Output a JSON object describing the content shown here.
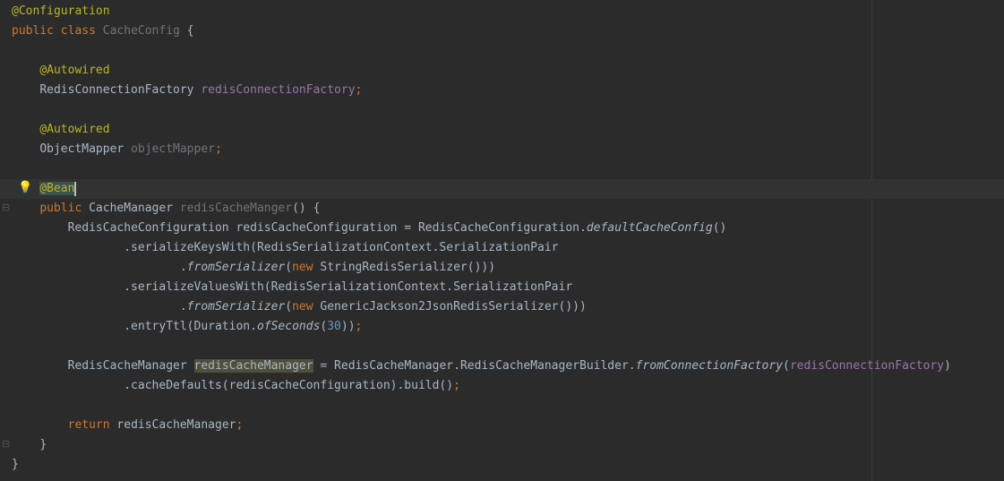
{
  "editor": {
    "language": "Java",
    "lines": [
      {
        "indent": "",
        "tokens": [
          {
            "t": "@Configuration",
            "c": "ann"
          }
        ]
      },
      {
        "indent": "",
        "tokens": [
          {
            "t": "public",
            "c": "kw"
          },
          {
            "t": " "
          },
          {
            "t": "class",
            "c": "kw"
          },
          {
            "t": " "
          },
          {
            "t": "CacheConfig",
            "c": "unused"
          },
          {
            "t": " {"
          }
        ]
      },
      {
        "indent": "",
        "tokens": []
      },
      {
        "indent": "    ",
        "tokens": [
          {
            "t": "@Autowired",
            "c": "ann"
          }
        ]
      },
      {
        "indent": "    ",
        "tokens": [
          {
            "t": "RedisConnectionFactory "
          },
          {
            "t": "redisConnectionFactory",
            "c": "fld"
          },
          {
            "t": ";",
            "c": "kw"
          }
        ]
      },
      {
        "indent": "",
        "tokens": []
      },
      {
        "indent": "    ",
        "tokens": [
          {
            "t": "@Autowired",
            "c": "ann"
          }
        ]
      },
      {
        "indent": "    ",
        "tokens": [
          {
            "t": "ObjectMapper "
          },
          {
            "t": "objectMapper",
            "c": "unused"
          },
          {
            "t": ";",
            "c": "kw"
          }
        ]
      },
      {
        "indent": "",
        "tokens": []
      },
      {
        "indent": "    ",
        "caret": true,
        "tokens": [
          {
            "t": "@Bean",
            "c": "ann sel-ann"
          }
        ]
      },
      {
        "indent": "    ",
        "tokens": [
          {
            "t": "public",
            "c": "kw"
          },
          {
            "t": " CacheManager "
          },
          {
            "t": "redisCacheManger",
            "c": "unused"
          },
          {
            "t": "() {"
          }
        ]
      },
      {
        "indent": "        ",
        "tokens": [
          {
            "t": "RedisCacheConfiguration redisCacheConfiguration = RedisCacheConfiguration."
          },
          {
            "t": "defaultCacheConfig",
            "c": "it"
          },
          {
            "t": "()"
          }
        ]
      },
      {
        "indent": "                ",
        "tokens": [
          {
            "t": ".serializeKeysWith(RedisSerializationContext.SerializationPair"
          }
        ]
      },
      {
        "indent": "                        ",
        "tokens": [
          {
            "t": "."
          },
          {
            "t": "fromSerializer",
            "c": "it"
          },
          {
            "t": "("
          },
          {
            "t": "new",
            "c": "kw"
          },
          {
            "t": " StringRedisSerializer()))"
          }
        ]
      },
      {
        "indent": "                ",
        "tokens": [
          {
            "t": ".serializeValuesWith(RedisSerializationContext.SerializationPair"
          }
        ]
      },
      {
        "indent": "                        ",
        "tokens": [
          {
            "t": "."
          },
          {
            "t": "fromSerializer",
            "c": "it"
          },
          {
            "t": "("
          },
          {
            "t": "new",
            "c": "kw"
          },
          {
            "t": " GenericJackson2JsonRedisSerializer()))"
          }
        ]
      },
      {
        "indent": "                ",
        "tokens": [
          {
            "t": ".entryTtl(Duration."
          },
          {
            "t": "ofSeconds",
            "c": "it"
          },
          {
            "t": "("
          },
          {
            "t": "30",
            "c": "num"
          },
          {
            "t": "))"
          },
          {
            "t": ";",
            "c": "kw"
          }
        ]
      },
      {
        "indent": "",
        "tokens": []
      },
      {
        "indent": "        ",
        "tokens": [
          {
            "t": "RedisCacheManager "
          },
          {
            "t": "redisCacheManager",
            "c": "occ"
          },
          {
            "t": " = RedisCacheManager.RedisCacheManagerBuilder."
          },
          {
            "t": "fromConnectionFactory",
            "c": "it"
          },
          {
            "t": "("
          },
          {
            "t": "redisConnectionFactory",
            "c": "fld"
          },
          {
            "t": ")"
          }
        ]
      },
      {
        "indent": "                ",
        "tokens": [
          {
            "t": ".cacheDefaults(redisCacheConfiguration).build()"
          },
          {
            "t": ";",
            "c": "kw"
          }
        ]
      },
      {
        "indent": "",
        "tokens": []
      },
      {
        "indent": "        ",
        "tokens": [
          {
            "t": "return",
            "c": "kw"
          },
          {
            "t": " redisCacheManager"
          },
          {
            "t": ";",
            "c": "kw"
          }
        ]
      },
      {
        "indent": "    ",
        "tokens": [
          {
            "t": "}"
          }
        ]
      },
      {
        "indent": "",
        "tokens": [
          {
            "t": "}"
          }
        ]
      }
    ]
  },
  "gutter": {
    "intention_icon": "lightbulb-icon",
    "fold_icon": "fold-marker-icon",
    "bulb_glyph": "💡",
    "fold_glyph": "⊟"
  },
  "colors": {
    "background": "#2b2b2b",
    "keyword": "#cc7832",
    "annotation": "#bbb529",
    "field": "#9876aa",
    "unused": "#72737a",
    "number": "#6897bb",
    "text": "#a9b7c6"
  }
}
